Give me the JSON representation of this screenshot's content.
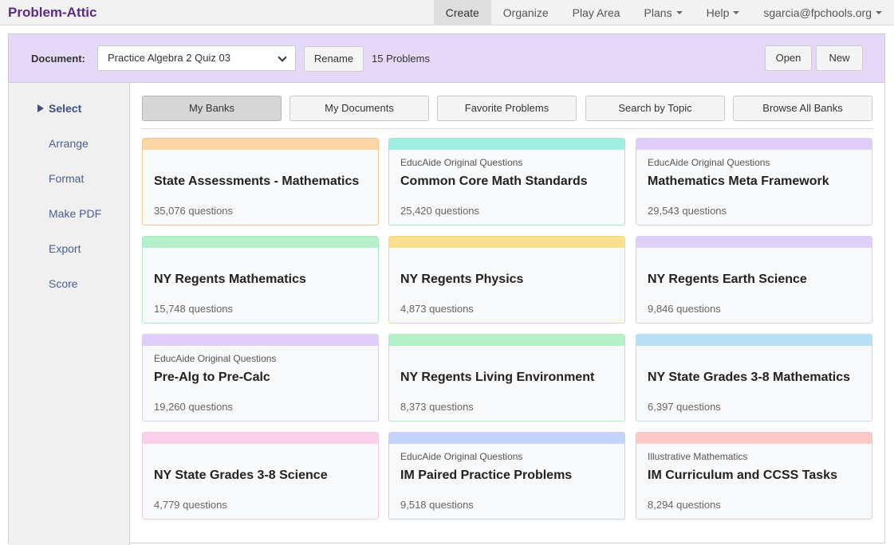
{
  "app": {
    "title": "Problem-Attic"
  },
  "nav": {
    "items": [
      {
        "label": "Create",
        "active": true,
        "dropdown": false
      },
      {
        "label": "Organize",
        "active": false,
        "dropdown": false
      },
      {
        "label": "Play Area",
        "active": false,
        "dropdown": false
      },
      {
        "label": "Plans",
        "active": false,
        "dropdown": true
      },
      {
        "label": "Help",
        "active": false,
        "dropdown": true
      },
      {
        "label": "sgarcia@fpchools.org",
        "active": false,
        "dropdown": true
      }
    ]
  },
  "docbar": {
    "label": "Document:",
    "selected_document": "Practice Algebra 2 Quiz 03",
    "rename_label": "Rename",
    "problem_count": "15 Problems",
    "open_label": "Open",
    "new_label": "New"
  },
  "sidebar": {
    "items": [
      {
        "label": "Select",
        "active": true
      },
      {
        "label": "Arrange",
        "active": false
      },
      {
        "label": "Format",
        "active": false
      },
      {
        "label": "Make PDF",
        "active": false
      },
      {
        "label": "Export",
        "active": false
      },
      {
        "label": "Score",
        "active": false
      }
    ]
  },
  "tabs": [
    {
      "label": "My Banks",
      "active": true
    },
    {
      "label": "My Documents",
      "active": false
    },
    {
      "label": "Favorite Problems",
      "active": false
    },
    {
      "label": "Search by Topic",
      "active": false
    },
    {
      "label": "Browse All Banks",
      "active": false
    }
  ],
  "banks": [
    {
      "org": "",
      "title": "State Assessments - Mathematics",
      "count": "35,076 questions",
      "stripe": "#fcd5a5",
      "border": "#f5c993"
    },
    {
      "org": "EducAide Original Questions",
      "title": "Common Core Math Standards",
      "count": "25,420 questions",
      "stripe": "#9ff0e0",
      "border": "#9fe6d8"
    },
    {
      "org": "EducAide Original Questions",
      "title": "Mathematics Meta Framework",
      "count": "29,543 questions",
      "stripe": "#e0cffa",
      "border": "#ddd0f4"
    },
    {
      "org": "",
      "title": "NY Regents Mathematics",
      "count": "15,748 questions",
      "stripe": "#b6f0cb",
      "border": "#b6e8c6"
    },
    {
      "org": "",
      "title": "NY Regents Physics",
      "count": "4,873 questions",
      "stripe": "#fbe08e",
      "border": "#f2da8e"
    },
    {
      "org": "",
      "title": "NY Regents Earth Science",
      "count": "9,846 questions",
      "stripe": "#e0cffa",
      "border": "#ddd0f4"
    },
    {
      "org": "EducAide Original Questions",
      "title": "Pre-Alg to Pre-Calc",
      "count": "19,260 questions",
      "stripe": "#e0cffa",
      "border": "#ddd0f4"
    },
    {
      "org": "",
      "title": "NY Regents Living Environment",
      "count": "8,373 questions",
      "stripe": "#b6f0cb",
      "border": "#b6e8c6"
    },
    {
      "org": "",
      "title": "NY State Grades 3-8 Mathematics",
      "count": "6,397 questions",
      "stripe": "#b8e1f8",
      "border": "#bcdcef"
    },
    {
      "org": "",
      "title": "NY State Grades 3-8 Science",
      "count": "4,779 questions",
      "stripe": "#fad0ea",
      "border": "#f3cfe3"
    },
    {
      "org": "EducAide Original Questions",
      "title": "IM Paired Practice Problems",
      "count": "9,518 questions",
      "stripe": "#c6d2fa",
      "border": "#c8d2f0"
    },
    {
      "org": "Illustrative Mathematics",
      "title": "IM Curriculum and CCSS Tasks",
      "count": "8,294 questions",
      "stripe": "#fcc9c9",
      "border": "#f3c8c8"
    }
  ]
}
